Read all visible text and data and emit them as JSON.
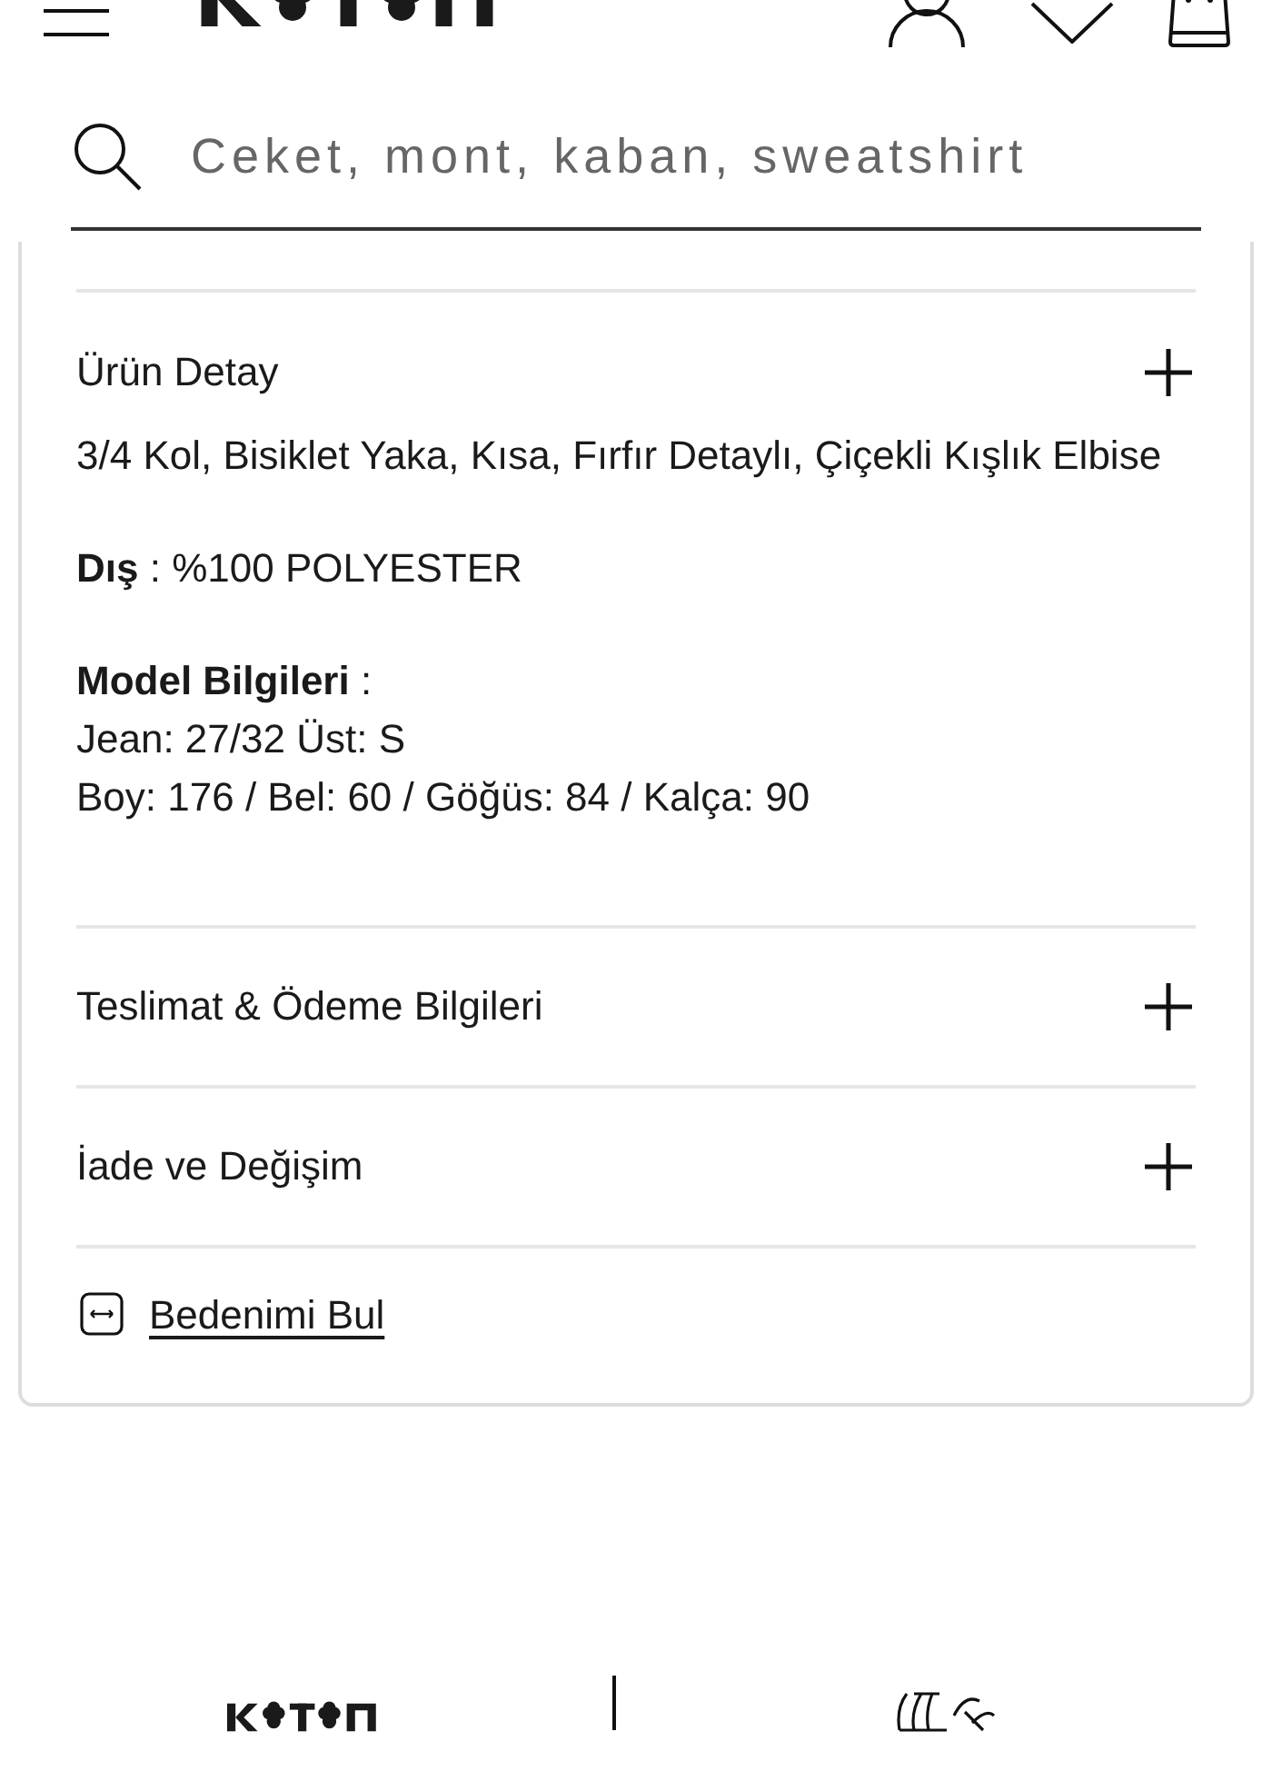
{
  "search": {
    "placeholder": "Ceket, mont, kaban, sweatshirt"
  },
  "detail": {
    "title": "Ürün Detay",
    "paragraphs": [
      {
        "lines": [
          "3/4 Kol, Bisiklet Yaka, Kısa, Fırfır Detaylı, Çiçekli Kışlık Elbise"
        ]
      },
      {
        "lines": [
          "**Dış** : %100 POLYESTER"
        ]
      },
      {
        "lines": [
          "**Model Bilgileri** :",
          "Jean: 27/32 Üst: S",
          "Boy: 176 / Bel: 60 / Göğüs: 84 / Kalça: 90"
        ]
      }
    ]
  },
  "sections": [
    {
      "title": "Teslimat & Ödeme Bilgileri"
    },
    {
      "title": "İade ve Değişim"
    }
  ],
  "size_link": {
    "label": "Bedenimi Bul"
  }
}
